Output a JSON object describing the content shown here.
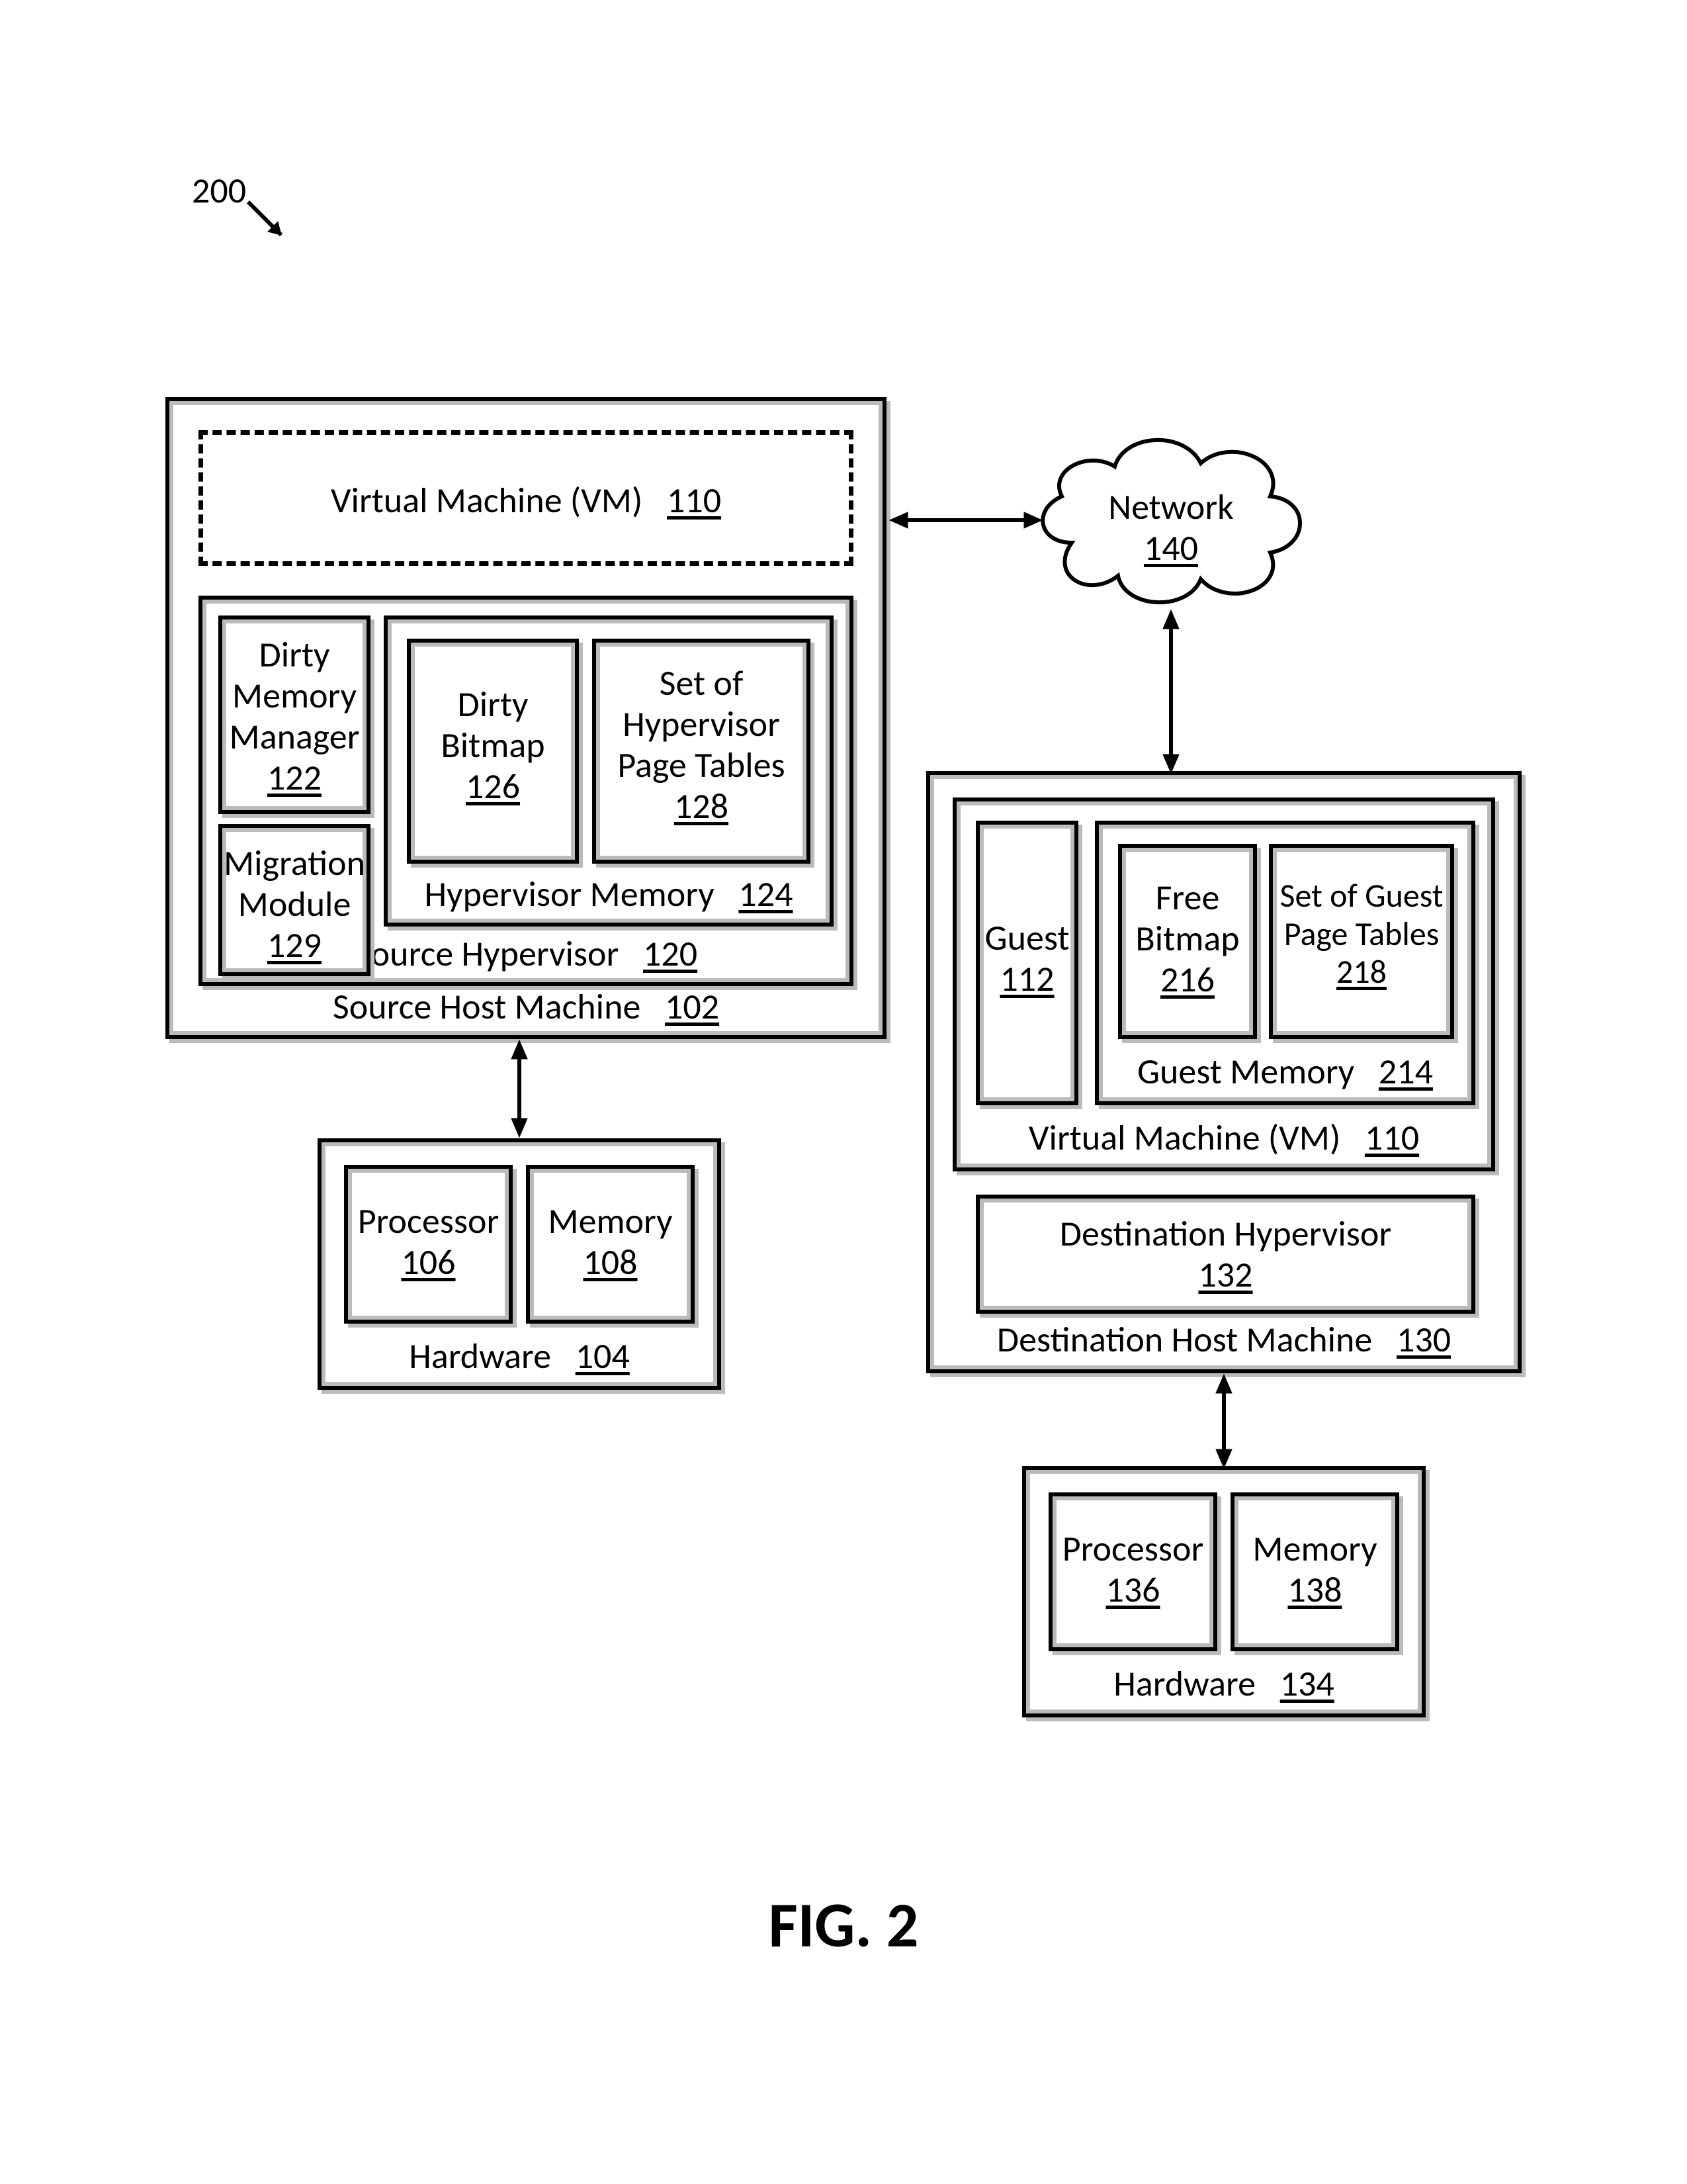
{
  "figure_ref": "200",
  "caption": "FIG. 2",
  "network": {
    "title": "Network",
    "ref": "140"
  },
  "source_host": {
    "title": "Source Host Machine",
    "ref": "102",
    "vm": {
      "title": "Virtual Machine (VM)",
      "ref": "110"
    },
    "hypervisor": {
      "title": "Source Hypervisor",
      "ref": "120",
      "dirty_mgr": {
        "l1": "Dirty",
        "l2": "Memory",
        "l3": "Manager",
        "ref": "122"
      },
      "migration": {
        "l1": "Migration",
        "l2": "Module",
        "ref": "129"
      },
      "hvmem": {
        "title": "Hypervisor Memory",
        "ref": "124",
        "dirty_bitmap": {
          "l1": "Dirty",
          "l2": "Bitmap",
          "ref": "126"
        },
        "hv_pt": {
          "l1": "Set of",
          "l2": "Hypervisor",
          "l3": "Page Tables",
          "ref": "128"
        }
      }
    }
  },
  "source_hw": {
    "title": "Hardware",
    "ref": "104",
    "processor": {
      "l1": "Processor",
      "ref": "106"
    },
    "memory": {
      "l1": "Memory",
      "ref": "108"
    }
  },
  "dest_host": {
    "title": "Destination Host Machine",
    "ref": "130",
    "hypervisor": {
      "l1": "Destination Hypervisor",
      "ref": "132"
    },
    "vm": {
      "title": "Virtual Machine (VM)",
      "ref": "110",
      "guest": {
        "l1": "Guest",
        "ref": "112"
      },
      "gmem": {
        "title": "Guest Memory",
        "ref": "214",
        "free_bitmap": {
          "l1": "Free",
          "l2": "Bitmap",
          "ref": "216"
        },
        "guest_pt": {
          "l1": "Set of Guest",
          "l2": "Page Tables",
          "ref": "218"
        }
      }
    }
  },
  "dest_hw": {
    "title": "Hardware",
    "ref": "134",
    "processor": {
      "l1": "Processor",
      "ref": "136"
    },
    "memory": {
      "l1": "Memory",
      "ref": "138"
    }
  }
}
